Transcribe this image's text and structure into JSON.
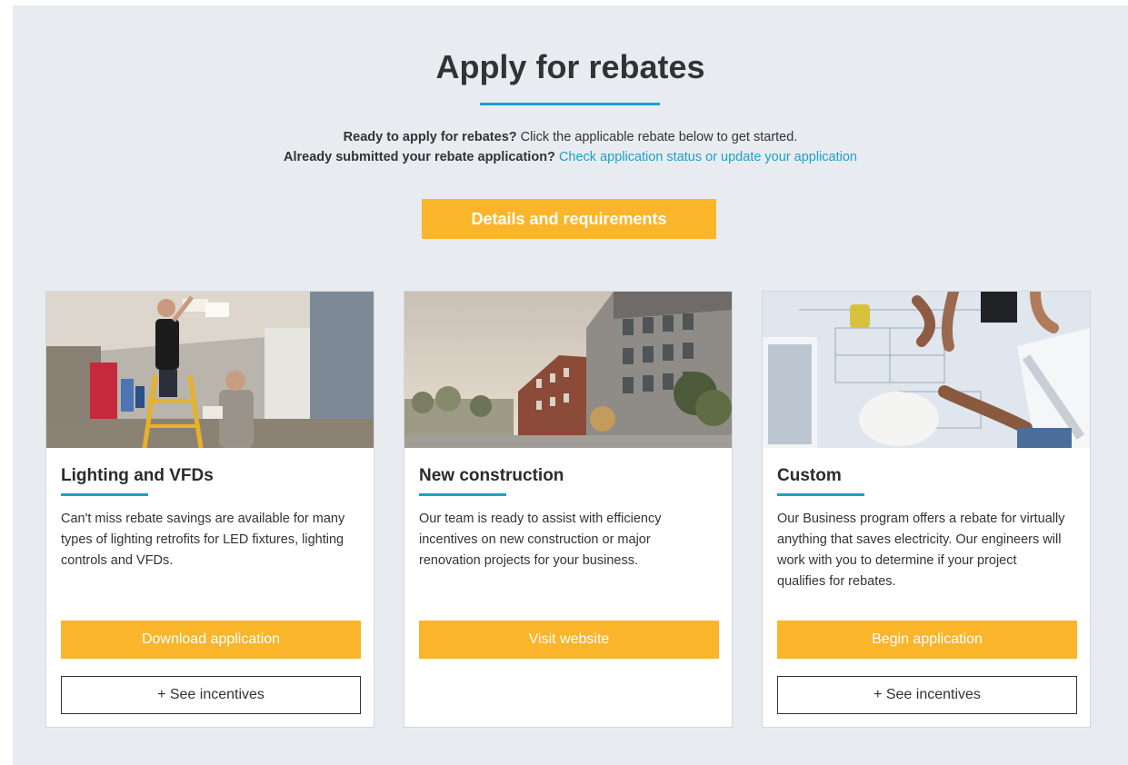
{
  "header": {
    "title": "Apply for rebates",
    "line1_bold": "Ready to apply for rebates?",
    "line1_text": " Click the applicable rebate below to get started.",
    "line2_bold": "Already submitted your rebate application?",
    "line2_link": "Check application status or update your application"
  },
  "details_button": "Details and requirements",
  "cards": [
    {
      "title": "Lighting and VFDs",
      "description": "Can't miss rebate savings are available for many types of lighting retrofits for LED fixtures, lighting controls and VFDs.",
      "primary_button": "Download application",
      "secondary_button": "+ See incentives"
    },
    {
      "title": "New construction",
      "description": "Our team is ready to assist with efficiency incentives on new construction or major renovation projects for your business.",
      "primary_button": "Visit website"
    },
    {
      "title": "Custom",
      "description": "Our Business program offers a rebate for virtually anything that saves electricity. Our engineers will work with you to determine if your project qualifies for rebates.",
      "primary_button": "Begin application",
      "secondary_button": "+ See incentives"
    }
  ],
  "colors": {
    "accent_yellow": "#fbb52a",
    "accent_blue": "#1fa0c9",
    "panel_bg": "#e8ecf1"
  }
}
